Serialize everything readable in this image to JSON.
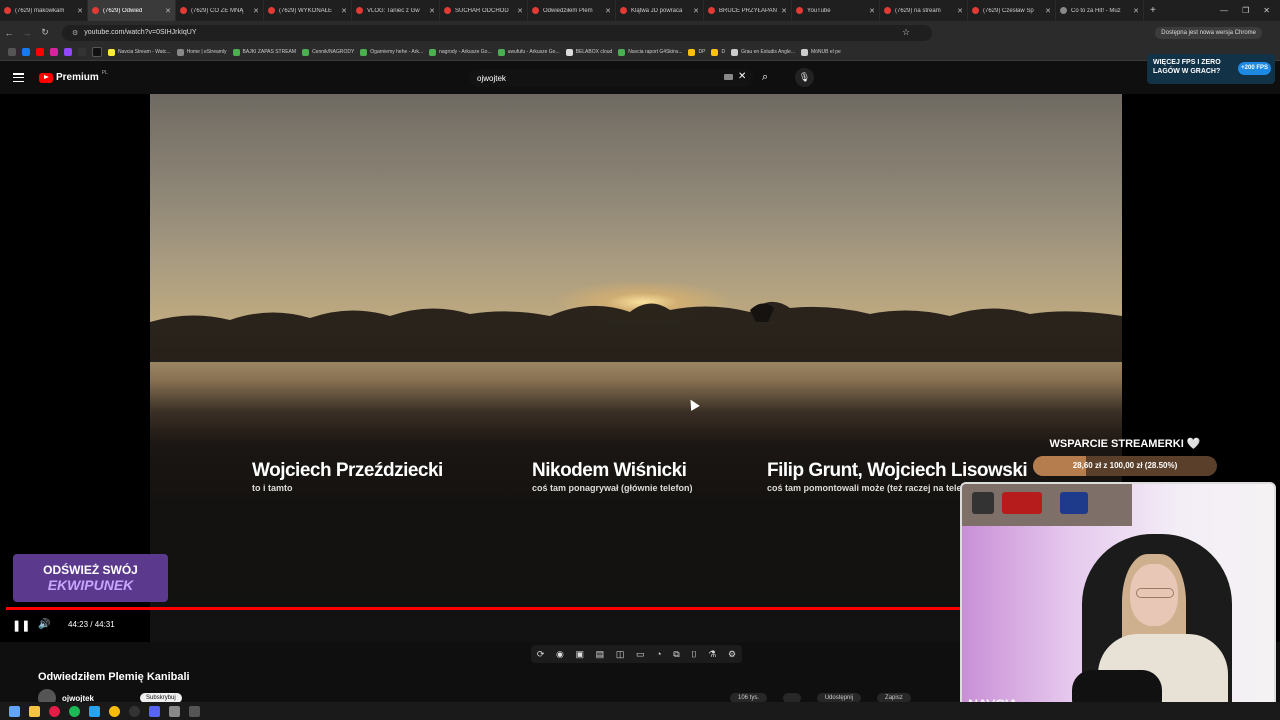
{
  "browser": {
    "tabs": [
      {
        "title": "(7629) makowkam"
      },
      {
        "title": "(7629) Odwied",
        "active": true
      },
      {
        "title": "(7629) CO ZE MNĄ"
      },
      {
        "title": "(7629) WYKONAŁE"
      },
      {
        "title": "VLOG: Taniec z Gw"
      },
      {
        "title": "SUCHAR ODCHOD"
      },
      {
        "title": "Odwiedziłem Plem"
      },
      {
        "title": "Klątwa JD powraca"
      },
      {
        "title": "BRUCE PRZYŁAPAN"
      },
      {
        "title": "YouTube"
      },
      {
        "title": "(7629) na stream"
      },
      {
        "title": "(7629) Czesław Śp"
      },
      {
        "title": "Co to za Hit! - Muz"
      }
    ],
    "url": "youtube.com/watch?v=0SIHJrkIqUY",
    "update_label": "Dostępna jest nowa wersja Chrome",
    "bookmarks": [
      "Navcia Stream - Watc...",
      "Home | eStreamly",
      "BAJKI ZAPAS STREAM",
      "Cennik/NAGRODY",
      "Ogarniemy hehe - Ark...",
      "nagrody - Arkusze Go...",
      "uwufufu - Arkusze Go...",
      "BELABOX cloud",
      "Navcia raport G4Skins...",
      "DP",
      "D",
      "Grau en Estudis Angle...",
      "MóNUB el pe"
    ]
  },
  "youtube": {
    "logo_text": "Premium",
    "logo_region": "PL",
    "search_value": "ojwojtek"
  },
  "ad": {
    "line1": "WIĘCEJ FPS I ZERO",
    "line2": "LAGÓW W GRACH?",
    "badge": "+200 FPS"
  },
  "video": {
    "credits": [
      {
        "name": "Wojciech Przeździecki",
        "role": "to i tamto"
      },
      {
        "name": "Nikodem Wiśnicki",
        "role": "coś tam ponagrywał (głównie telefon)"
      },
      {
        "name": "Filip Grunt, Wojciech Lisowski",
        "role": "coś tam pomontowali może (też raczej na telefon"
      }
    ],
    "time": "44:23 / 44:31",
    "progress": 0.997,
    "title": "Odwiedziłem Plemię Kanibali",
    "channel": "ojwojtek",
    "subscribe": "Subskrybuj",
    "actions": [
      "106 tys.",
      "",
      "Udostępnij",
      "Zapisz"
    ]
  },
  "overlay": {
    "support_title": "WSPARCIE STREAMERKI 🤍",
    "support_bar": "28,60 zł z 100,00 zł (28.50%)",
    "support_fraction": 0.286,
    "promo_line1": "ODŚWIEŻ SWÓJ",
    "promo_line2": "EKWIPUNEK",
    "cam_label": "NAVCIA"
  }
}
